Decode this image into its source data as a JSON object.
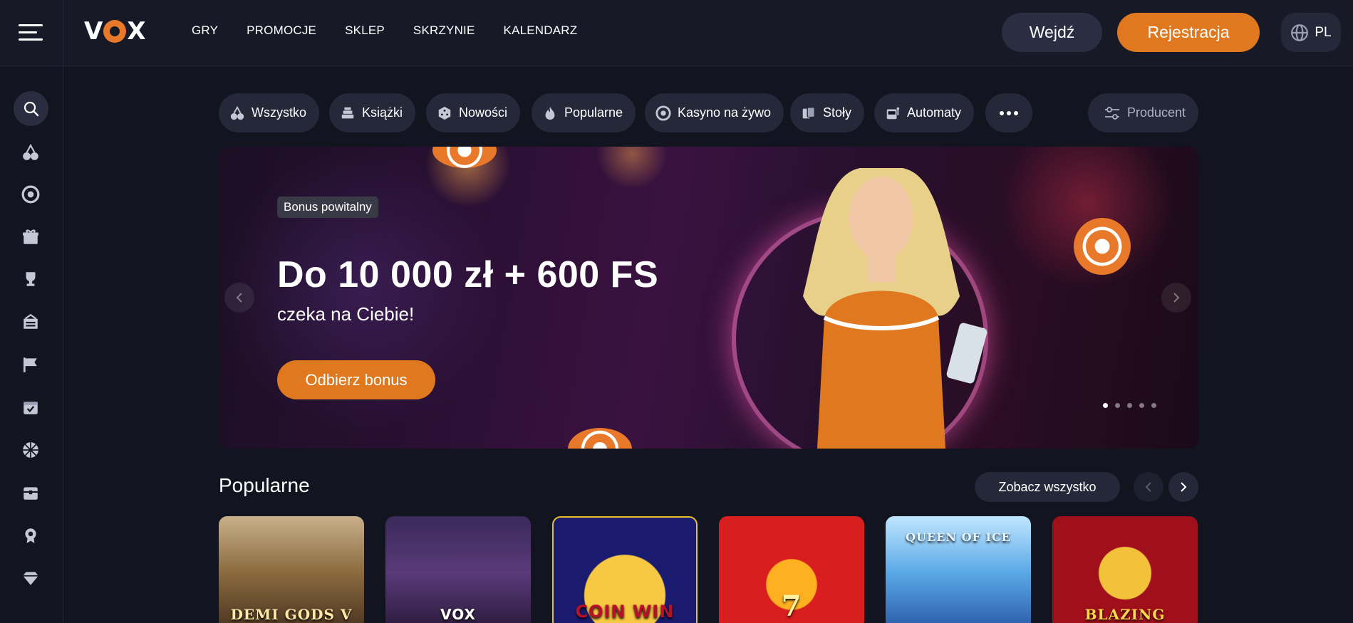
{
  "header": {
    "logo": "VOX",
    "nav": [
      "GRY",
      "PROMOCJE",
      "SKLEP",
      "SKRZYNIE",
      "KALENDARZ"
    ],
    "login_label": "Wejdź",
    "register_label": "Rejestracja",
    "language": "PL"
  },
  "sidebar": {
    "icons": [
      "search-icon",
      "cherries-icon",
      "roulette-icon",
      "gift-icon",
      "trophy-icon",
      "ticket-icon",
      "race-flag-icon",
      "calendar-check-icon",
      "wheel-icon",
      "chest-icon",
      "badge-icon",
      "diamond-icon"
    ]
  },
  "categories": {
    "items": [
      {
        "label": "Wszystko",
        "icon": "cherries-icon"
      },
      {
        "label": "Książki",
        "icon": "books-icon"
      },
      {
        "label": "Nowości",
        "icon": "dice-icon"
      },
      {
        "label": "Popularne",
        "icon": "fire-icon"
      },
      {
        "label": "Kasyno na żywo",
        "icon": "roulette-icon"
      },
      {
        "label": "Stoły",
        "icon": "cards-icon"
      },
      {
        "label": "Automaty",
        "icon": "slot-machine-icon"
      }
    ],
    "producer_label": "Producent"
  },
  "banner": {
    "badge": "Bonus powitalny",
    "headline": "Do 10 000 zł + 600 FS",
    "subline": "czeka na Ciebie!",
    "cta": "Odbierz bonus",
    "slides": 5,
    "active_slide": 1,
    "colors": {
      "accent": "#e0781f"
    }
  },
  "popular": {
    "title": "Popularne",
    "see_all": "Zobacz wszystko",
    "games": [
      "DEMI GODS V",
      "VOX",
      "COIN WIN",
      "7",
      "QUEEN OF ICE",
      "BLAZING"
    ]
  }
}
